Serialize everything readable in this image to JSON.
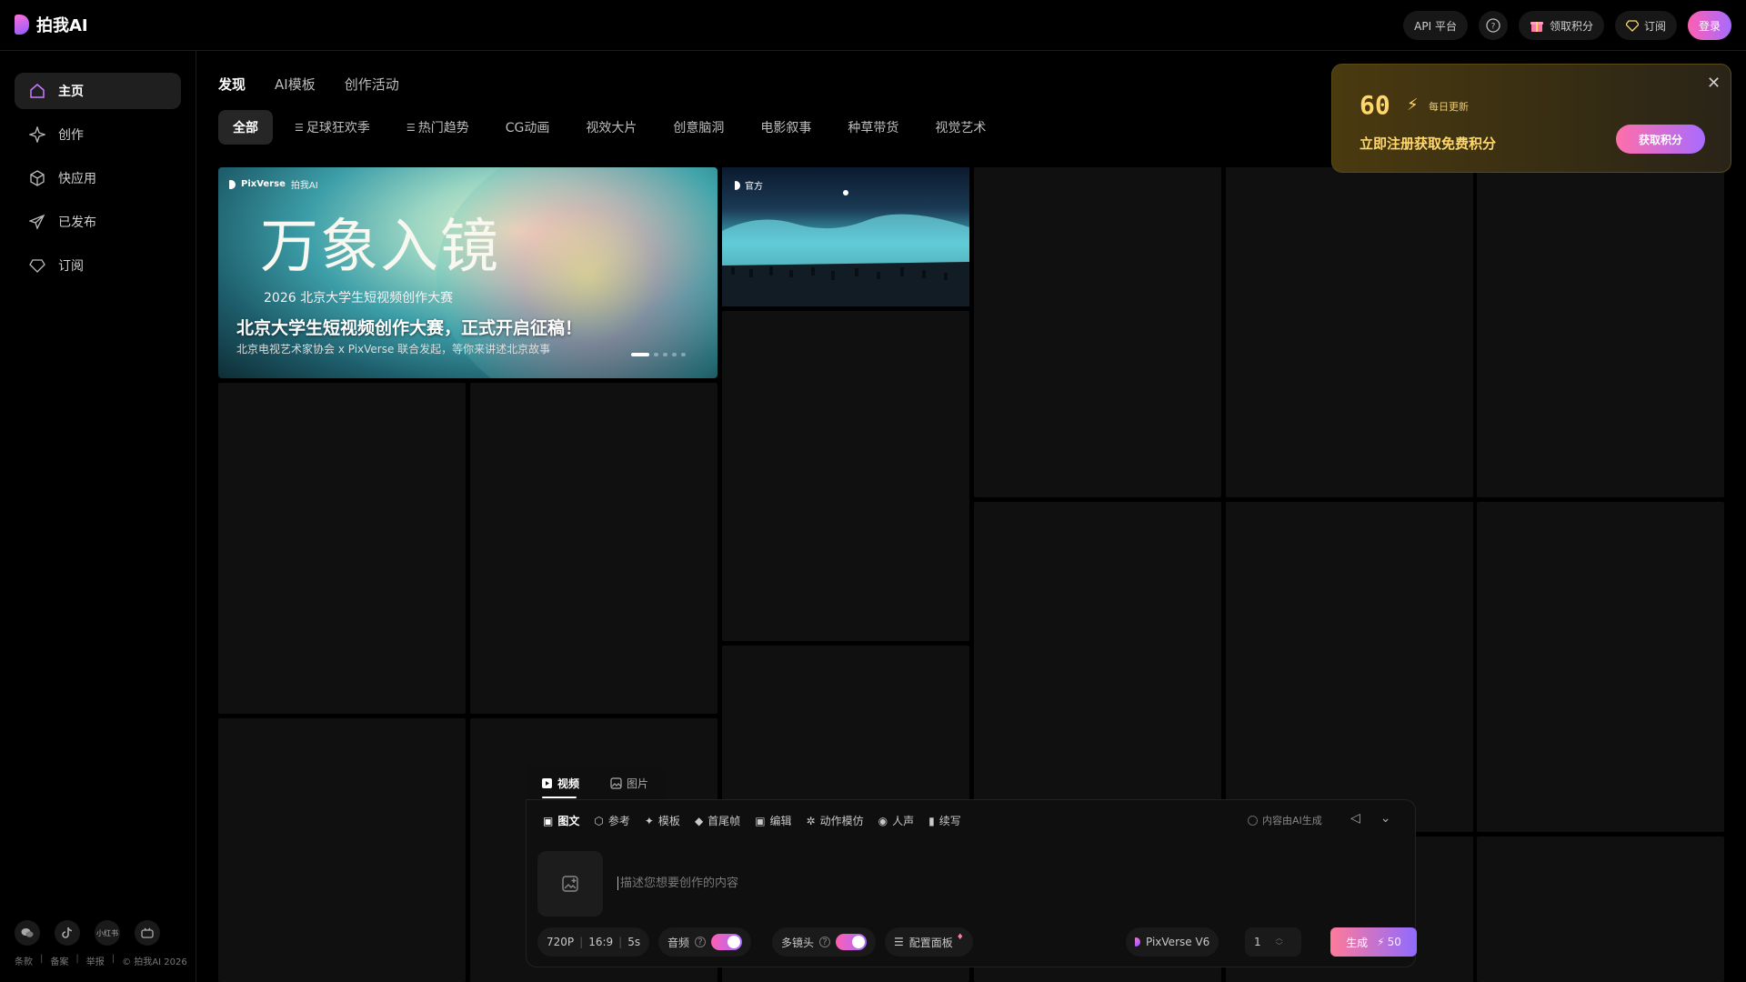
{
  "brand": {
    "name": "拍我AI"
  },
  "header": {
    "api": "API 平台",
    "claim": "领取积分",
    "subscribe": "订阅",
    "login": "登录"
  },
  "sidebar": {
    "items": [
      {
        "label": "主页",
        "icon": "home-icon"
      },
      {
        "label": "创作",
        "icon": "sparkle-icon"
      },
      {
        "label": "快应用",
        "icon": "cube-icon"
      },
      {
        "label": "已发布",
        "icon": "send-icon"
      },
      {
        "label": "订阅",
        "icon": "diamond-icon"
      }
    ],
    "social": [
      "wechat-icon",
      "tiktok-icon",
      "xiaohongshu-icon",
      "bilibili-icon"
    ],
    "social_text": "小红书",
    "footer": [
      "条款",
      "备案",
      "举报",
      "© 拍我AI 2026"
    ]
  },
  "tabs": [
    "发现",
    "AI模板",
    "创作活动"
  ],
  "chips": [
    "全部",
    "足球狂欢季",
    "热门趋势",
    "CG动画",
    "视效大片",
    "创意脑洞",
    "电影叙事",
    "种草带货",
    "视觉艺术"
  ],
  "hero": {
    "brand": "PixVerse",
    "brand2": "拍我AI",
    "art_title": "万象入镜",
    "art_sub": "2026 北京大学生短视频创作大赛",
    "headline": "北京大学生短视频创作大赛，正式开启征稿！",
    "desc": "北京电视艺术家协会 x PixVerse 联合发起，等你来讲述北京故事",
    "slide_index": 1,
    "slide_count": 5
  },
  "card2": {
    "badge": "官方"
  },
  "promo": {
    "points": "60",
    "tag": "每日更新",
    "text": "立即注册获取免费积分",
    "button": "获取积分"
  },
  "composer": {
    "tabs": [
      "视频",
      "图片"
    ],
    "tools": [
      "图文",
      "参考",
      "模板",
      "首尾帧",
      "编辑",
      "动作模仿",
      "人声",
      "续写"
    ],
    "ai_note": "内容由AI生成",
    "placeholder": "描述您想要创作的内容",
    "resolution": "720P",
    "ratio": "16:9",
    "duration": "5s",
    "audio": "音频",
    "multi_shot": "多镜头",
    "config": "配置面板",
    "model": "PixVerse V6",
    "count": "1",
    "generate": "生成",
    "cost": "50"
  },
  "colors": {
    "accent_pink": "#ff5fb2",
    "accent_purple": "#a66bff",
    "promo_gold": "#ffd76a"
  }
}
